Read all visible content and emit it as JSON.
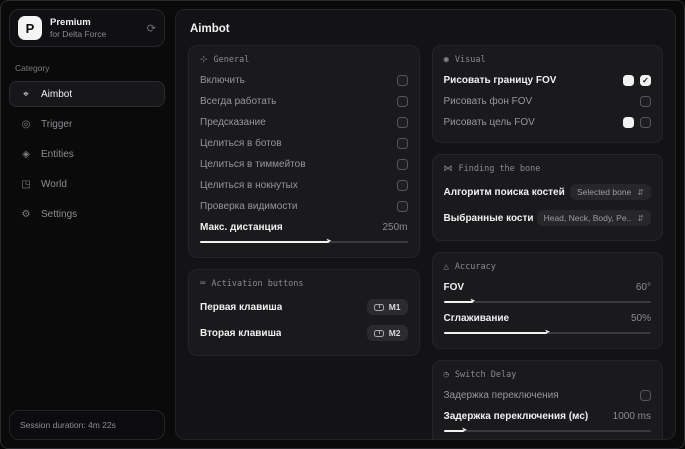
{
  "app": {
    "logo_letter": "P",
    "title": "Premium",
    "subtitle": "for Delta Force"
  },
  "colors": {
    "accent": "#f2f2f3",
    "panel_bg": "#1a1a1d",
    "page_bg": "#0a0a0b",
    "muted_text": "#96969b"
  },
  "icons": {
    "refresh": "⟳",
    "aimbot": "⌖",
    "trigger": "◎",
    "entities": "◈",
    "world": "◳",
    "settings": "⚙",
    "general": "⊹",
    "activation": "⌨",
    "visual": "◉",
    "bone": "⋈",
    "accuracy": "△",
    "switch_delay": "◷",
    "check": "✓",
    "expand": "⇵",
    "thumb": "➤"
  },
  "sidebar": {
    "category_label": "Category",
    "items": [
      {
        "label": "Aimbot"
      },
      {
        "label": "Trigger"
      },
      {
        "label": "Entities"
      },
      {
        "label": "World"
      },
      {
        "label": "Settings"
      }
    ],
    "session_label": "Session duration: 4m 22s"
  },
  "header": {
    "title": "Aimbot"
  },
  "panels": {
    "general": {
      "title": "General",
      "rows": [
        {
          "label": "Включить"
        },
        {
          "label": "Всегда работать"
        },
        {
          "label": "Предсказание"
        },
        {
          "label": "Целиться в ботов"
        },
        {
          "label": "Целиться в тиммейтов"
        },
        {
          "label": "Целиться в нокнутых"
        },
        {
          "label": "Проверка видимости"
        }
      ],
      "slider": {
        "label": "Макс. дистанция",
        "value": "250m",
        "percent": 62
      }
    },
    "activation": {
      "title": "Activation buttons",
      "rows": [
        {
          "label": "Первая клавиша",
          "key": "M1"
        },
        {
          "label": "Вторая клавиша",
          "key": "M2"
        }
      ]
    },
    "visual": {
      "title": "Visual",
      "rows": [
        {
          "label": "Рисовать границу FOV",
          "checked": true
        },
        {
          "label": "Рисовать фон FOV",
          "checked": false
        },
        {
          "label": "Рисовать цель FOV",
          "checked": false
        }
      ]
    },
    "bone": {
      "title": "Finding the bone",
      "rows": [
        {
          "label": "Алгоритм поиска костей",
          "value": "Selected bone"
        },
        {
          "label": "Выбранные кости",
          "value": "Head, Neck, Body, Pe.."
        }
      ]
    },
    "accuracy": {
      "title": "Accuracy",
      "sliders": [
        {
          "label": "FOV",
          "value": "60°",
          "percent": 14
        },
        {
          "label": "Сглаживание",
          "value": "50%",
          "percent": 50
        }
      ]
    },
    "switch_delay": {
      "title": "Switch Delay",
      "checkbox_label": "Задержка переключения",
      "slider": {
        "label": "Задержка переключения (мс)",
        "value": "1000 ms",
        "percent": 10
      }
    }
  }
}
